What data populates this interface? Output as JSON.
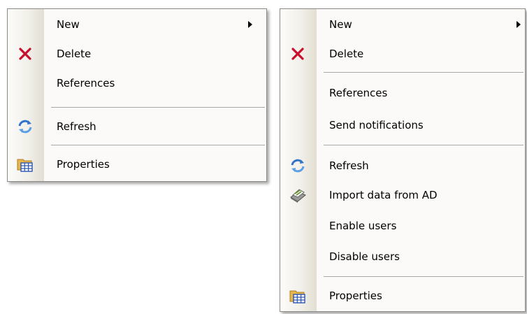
{
  "menus": [
    {
      "items": [
        {
          "label": "New",
          "has_submenu": true,
          "icon": ""
        },
        {
          "label": "Delete",
          "icon": "delete-icon"
        },
        {
          "label": "References",
          "icon": ""
        },
        {
          "label": "Refresh",
          "icon": "refresh-icon"
        },
        {
          "label": "Properties",
          "icon": "properties-icon"
        }
      ]
    },
    {
      "items": [
        {
          "label": "New",
          "has_submenu": true,
          "icon": ""
        },
        {
          "label": "Delete",
          "icon": "delete-icon"
        },
        {
          "label": "References",
          "icon": ""
        },
        {
          "label": "Send notifications",
          "icon": ""
        },
        {
          "label": "Refresh",
          "icon": "refresh-icon"
        },
        {
          "label": "Import data from AD",
          "icon": "import-icon"
        },
        {
          "label": "Enable users",
          "icon": ""
        },
        {
          "label": "Disable users",
          "icon": ""
        },
        {
          "label": "Properties",
          "icon": "properties-icon"
        }
      ]
    }
  ],
  "colors": {
    "delete_icon": "#c8102e",
    "refresh_icon": "#2f74c9",
    "properties_folder": "#e8b54a",
    "properties_grid": "#2a55b5",
    "separator": "#a9a7a1"
  }
}
